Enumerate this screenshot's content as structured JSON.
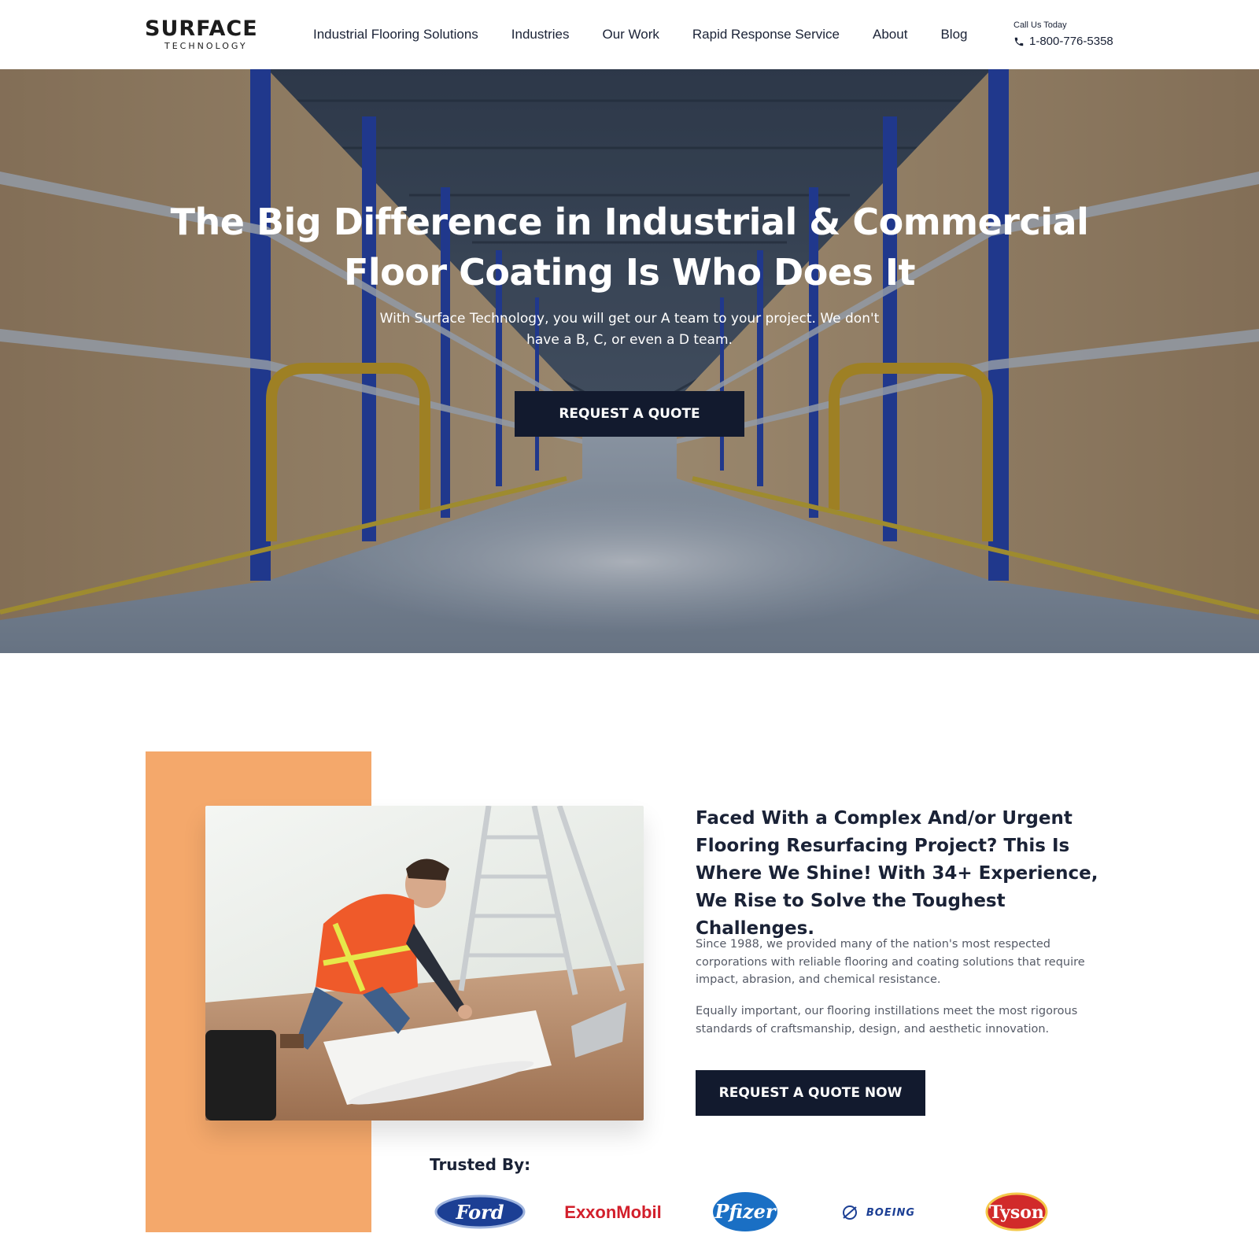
{
  "header": {
    "logo": {
      "name": "SURFACE",
      "tagline": "TECHNOLOGY"
    },
    "nav": [
      {
        "label": "Industrial Flooring Solutions"
      },
      {
        "label": "Industries"
      },
      {
        "label": "Our Work"
      },
      {
        "label": "Rapid Response Service"
      },
      {
        "label": "About"
      },
      {
        "label": "Blog"
      }
    ],
    "call": {
      "label": "Call Us Today",
      "phone": "1-800-776-5358",
      "icon": "phone-icon"
    }
  },
  "hero": {
    "title": "The Big Difference in Industrial & Commercial Floor Coating Is Who Does It",
    "subtitle": "With Surface Technology, you will get our A team to your project. We don't have a B, C, or even a D team.",
    "cta": "REQUEST A QUOTE"
  },
  "about": {
    "title": "Faced With a Complex And/or Urgent Flooring Resurfacing Project? This Is Where We Shine! With 34+ Experience, We Rise to Solve the Toughest Challenges.",
    "paragraphs": [
      "Since 1988, we provided many of the nation's most respected corporations with reliable flooring and coating solutions that require impact, abrasion, and chemical resistance.",
      "Equally important, our flooring instillations meet the most rigorous standards of craftsmanship, design, and aesthetic innovation."
    ],
    "cta": "REQUEST A QUOTE NOW"
  },
  "trusted": {
    "label": "Trusted By:",
    "brands": [
      "Ford",
      "ExxonMobil",
      "Pfizer",
      "BOEING",
      "Tyson"
    ]
  },
  "colors": {
    "accent_orange": "#f4a86b",
    "logo_orange": "#e98624",
    "navy": "#121a2e",
    "text_dark": "#1a2236",
    "text_muted": "#555a66"
  }
}
